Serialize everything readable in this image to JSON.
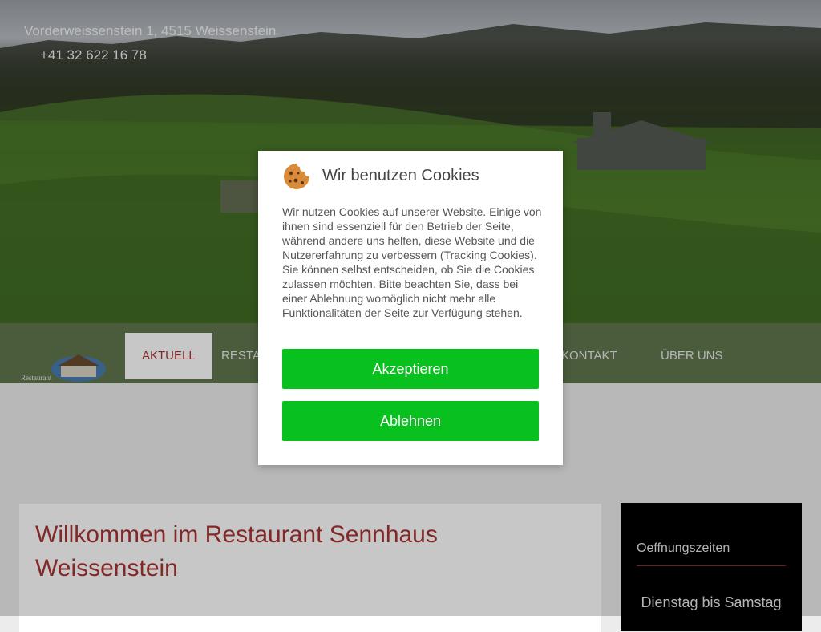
{
  "header": {
    "address": "Vorderweissenstein 1, 4515 Weissenstein",
    "phone": "+41 32 622 16 78"
  },
  "nav": {
    "items": [
      {
        "label": "AKTUELL",
        "active": true
      },
      {
        "label": "RESTA",
        "active": false
      },
      {
        "label": "KONTAKT",
        "active": false
      },
      {
        "label": "ÜBER UNS",
        "active": false
      }
    ]
  },
  "logo": {
    "text": "Restaurant"
  },
  "main": {
    "title": "Willkommen im Restaurant Sennhaus Weissenstein"
  },
  "sidebar": {
    "title": "Oeffnungszeiten",
    "hours_heading": "Dienstag bis Samstag"
  },
  "cookie_dialog": {
    "icon": "cookie-icon",
    "title": "Wir benutzen Cookies",
    "text": "Wir nutzen Cookies auf unserer Website. Einige von ihnen sind essenziell für den Betrieb der Seite, während andere uns helfen, diese Website und die Nutzererfahrung zu verbessern (Tracking Cookies). Sie können selbst entscheiden, ob Sie die Cookies zulassen möchten. Bitte beachten Sie, dass bei einer Ablehnung womöglich nicht mehr alle Funktionalitäten der Seite zur Verfügung stehen.",
    "accept_label": "Akzeptieren",
    "decline_label": "Ablehnen"
  },
  "colors": {
    "accent": "#a83232",
    "button": "#08c01e"
  }
}
